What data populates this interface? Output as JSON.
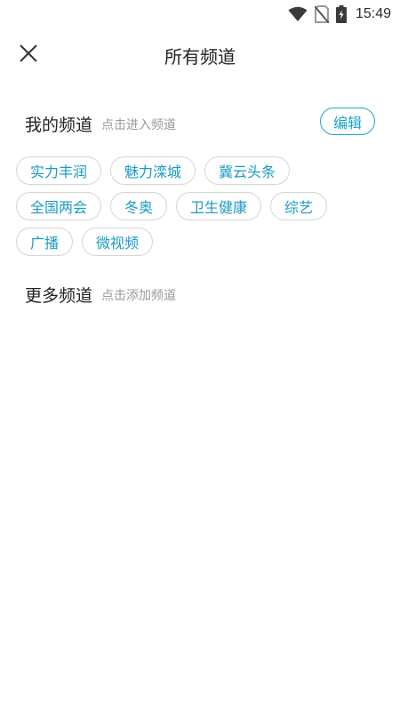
{
  "status_bar": {
    "time": "15:49",
    "icons": [
      "wifi-icon",
      "no-sim-icon",
      "battery-charging-icon"
    ]
  },
  "header": {
    "title": "所有频道",
    "close_icon": "close-icon"
  },
  "my_channels": {
    "title": "我的频道",
    "hint": "点击进入频道",
    "edit_label": "编辑",
    "items": [
      {
        "label": "实力丰润"
      },
      {
        "label": "魅力滦城"
      },
      {
        "label": "冀云头条"
      },
      {
        "label": "全国两会"
      },
      {
        "label": "冬奥"
      },
      {
        "label": "卫生健康"
      },
      {
        "label": "综艺"
      },
      {
        "label": "广播"
      },
      {
        "label": "微视频"
      }
    ]
  },
  "more_channels": {
    "title": "更多频道",
    "hint": "点击添加频道"
  },
  "colors": {
    "accent": "#1ea2c8",
    "chip_border": "#d6d6d6",
    "hint_text": "#9a9a9a"
  }
}
